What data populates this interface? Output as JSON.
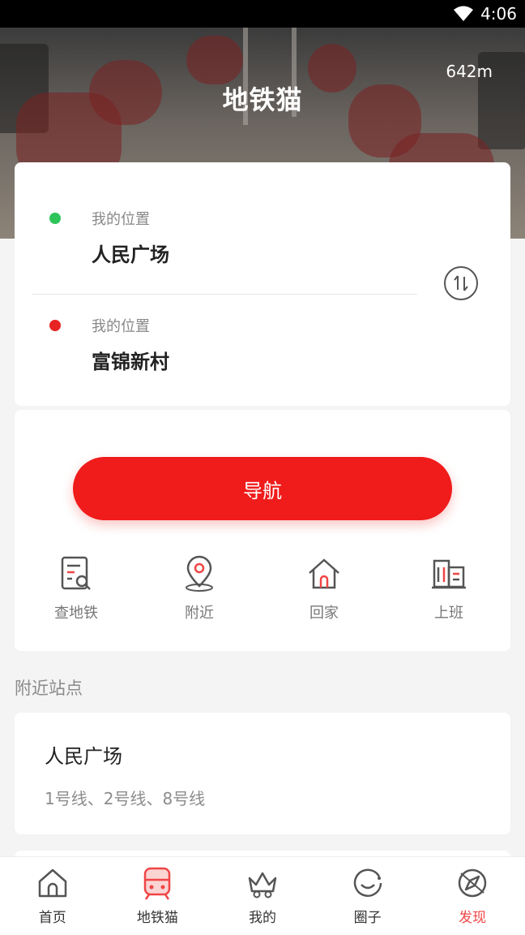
{
  "status_bar": {
    "time": "4:06"
  },
  "header": {
    "title": "地铁猫",
    "distance": "642m"
  },
  "route": {
    "origin": {
      "hint": "我的位置",
      "name": "人民广场",
      "dot_color": "#2ec45a"
    },
    "destination": {
      "hint": "我的位置",
      "name": "富锦新村",
      "dot_color": "#e82323"
    },
    "swap_icon": "swap-vertical-icon"
  },
  "actions": {
    "navigate_label": "导航",
    "quick": [
      {
        "label": "查地铁",
        "icon": "search-metro-icon"
      },
      {
        "label": "附近",
        "icon": "location-pin-icon"
      },
      {
        "label": "回家",
        "icon": "home-icon"
      },
      {
        "label": "上班",
        "icon": "office-building-icon"
      }
    ]
  },
  "nearby": {
    "section_title": "附近站点",
    "stations": [
      {
        "name": "人民广场",
        "lines": "1号线、2号线、8号线"
      }
    ]
  },
  "tabbar": {
    "tabs": [
      {
        "label": "首页",
        "icon": "home-icon"
      },
      {
        "label": "地铁猫",
        "icon": "train-icon"
      },
      {
        "label": "我的",
        "icon": "crown-icon"
      },
      {
        "label": "圈子",
        "icon": "smile-icon"
      },
      {
        "label": "发现",
        "icon": "compass-icon"
      }
    ],
    "active_index": 1
  },
  "colors": {
    "accent": "#f01b1b",
    "active_tab": "#f04545"
  }
}
